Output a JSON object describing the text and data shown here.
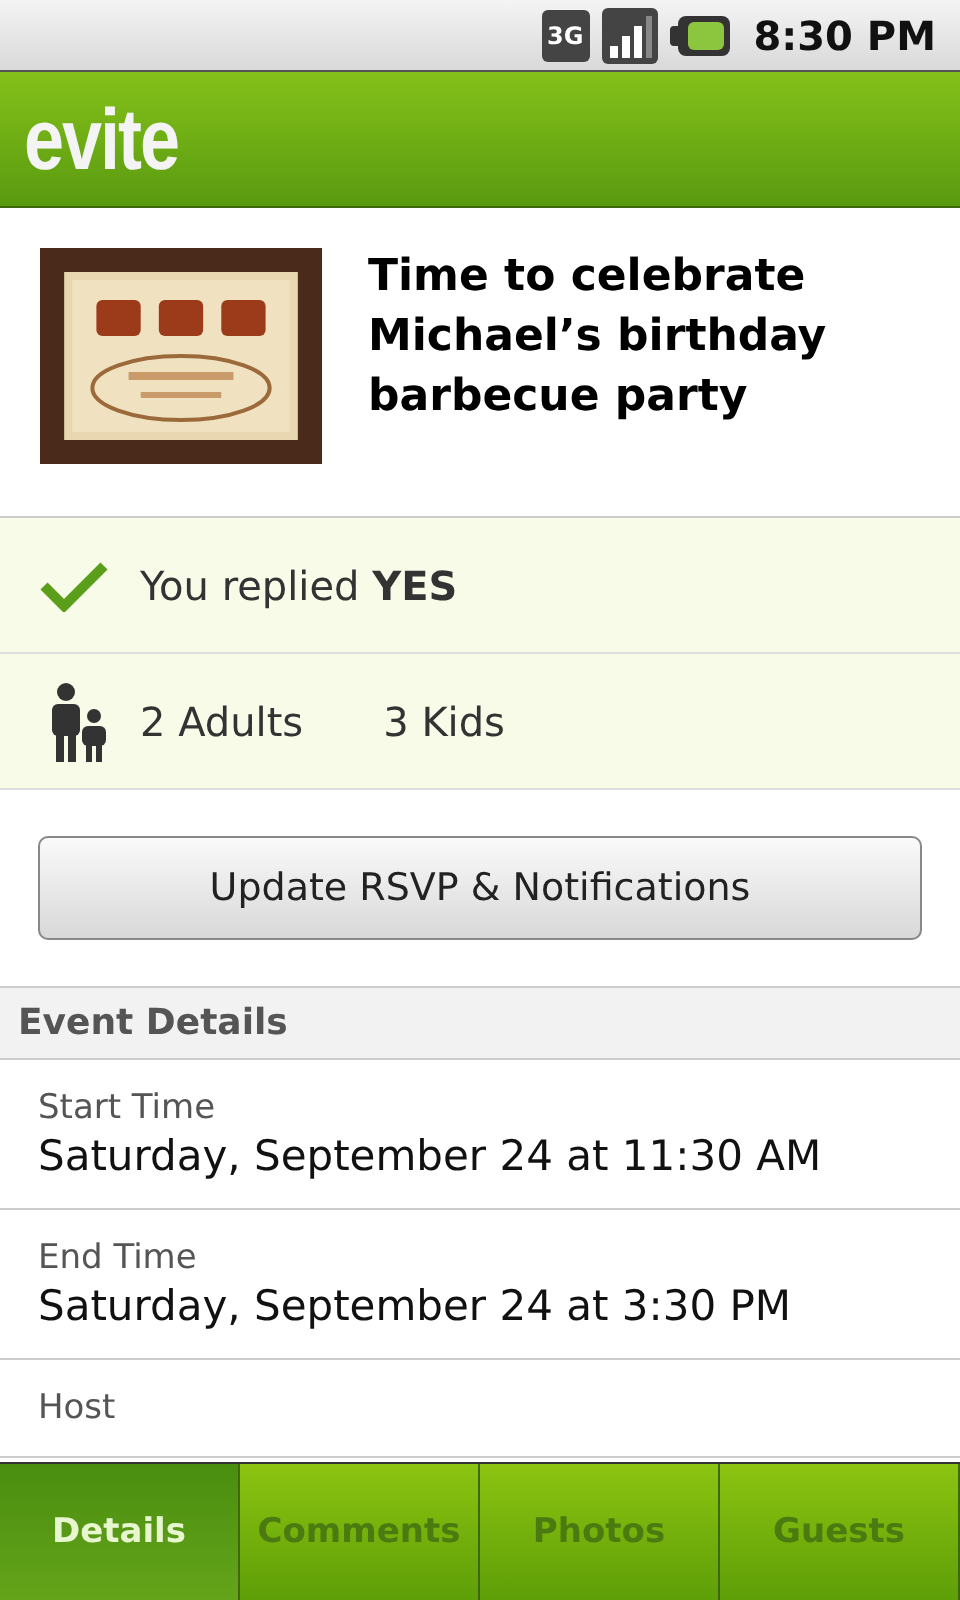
{
  "status_bar": {
    "network": "3G",
    "time": "8:30 PM"
  },
  "app_bar": {
    "logo": "evite"
  },
  "event": {
    "title": "Time to celebrate Michael’s birthday barbecue party"
  },
  "rsvp": {
    "prefix": "You replied ",
    "answer": "YES"
  },
  "attendees": [
    {
      "count": "2 Adults"
    },
    {
      "count": "3 Kids"
    }
  ],
  "update_button": "Update RSVP & Notifications",
  "section": "Event Details",
  "details": [
    {
      "label": "Start Time",
      "value": "Saturday, September 24 at 11:30 AM"
    },
    {
      "label": "End Time",
      "value": "Saturday, September 24 at 3:30 PM"
    },
    {
      "label": "Host"
    }
  ],
  "tabs": [
    {
      "label": "Details",
      "selected": true
    },
    {
      "label": "Comments",
      "selected": false
    },
    {
      "label": "Photos",
      "selected": false
    },
    {
      "label": "Guests",
      "selected": false
    }
  ]
}
